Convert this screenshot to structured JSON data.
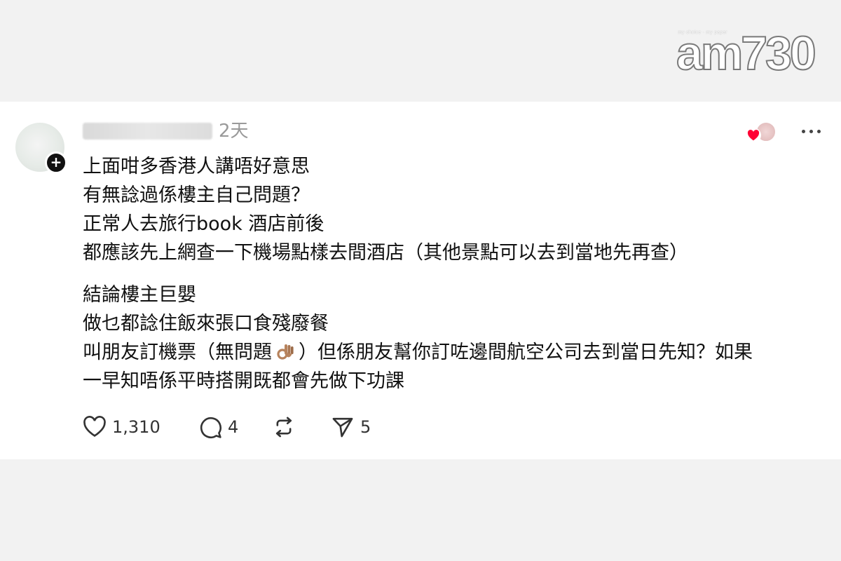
{
  "watermark": {
    "tagline": "my choice · my paper",
    "brand": "am730"
  },
  "post": {
    "timestamp": "2天",
    "follow_badge": "+",
    "paragraphs": [
      {
        "lines": [
          "上面咁多香港人講唔好意思",
          "有無諗過係樓主自己問題？",
          "正常人去旅行book 酒店前後",
          "都應該先上網查一下機場點樣去間酒店（其他景點可以去到當地先再查）"
        ]
      },
      {
        "lines": [
          "結論樓主巨嬰",
          "做乜都諗住飯來張口食殘廢餐"
        ],
        "line_emoji_before": "叫朋友訂機票（無問題",
        "line_emoji_after": "）但係朋友幫你訂咗邊間航空公司去到當日先知？如果",
        "last_line": "一早知唔係平時搭開既都會先做下功課"
      }
    ],
    "emoji_icon": "ok-hand-emoji",
    "actions": {
      "likes": "1,310",
      "replies": "4",
      "reposts": "",
      "shares": "5"
    },
    "icons": [
      "heart-icon",
      "comment-icon",
      "repost-icon",
      "send-icon",
      "more-icon"
    ],
    "colors": {
      "like_red": "#ff0034",
      "timestamp_gray": "#9a9a9a",
      "card_bg": "#ffffff",
      "page_bg": "#f2f2f2"
    }
  }
}
